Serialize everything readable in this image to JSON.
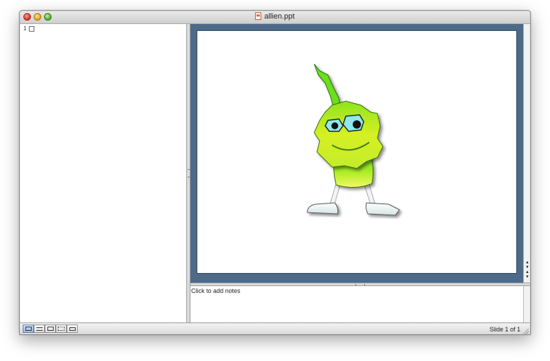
{
  "window": {
    "title": "allien.ppt",
    "icon": "ppt-document-icon"
  },
  "slides_pane": {
    "items": [
      {
        "number": "1",
        "icon": "slide-thumbnail-icon"
      }
    ]
  },
  "slide": {
    "background_color": "#ffffff",
    "frame_color": "#4e6a89",
    "content": "alien-illustration"
  },
  "notes": {
    "placeholder": "Click to add notes"
  },
  "statusbar": {
    "view_buttons": [
      {
        "name": "normal-view",
        "active": true
      },
      {
        "name": "outline-view",
        "active": false
      },
      {
        "name": "slide-view",
        "active": false
      },
      {
        "name": "slide-sorter-view",
        "active": false
      },
      {
        "name": "slide-show-view",
        "active": false
      }
    ],
    "slide_counter": "Slide 1 of 1"
  }
}
